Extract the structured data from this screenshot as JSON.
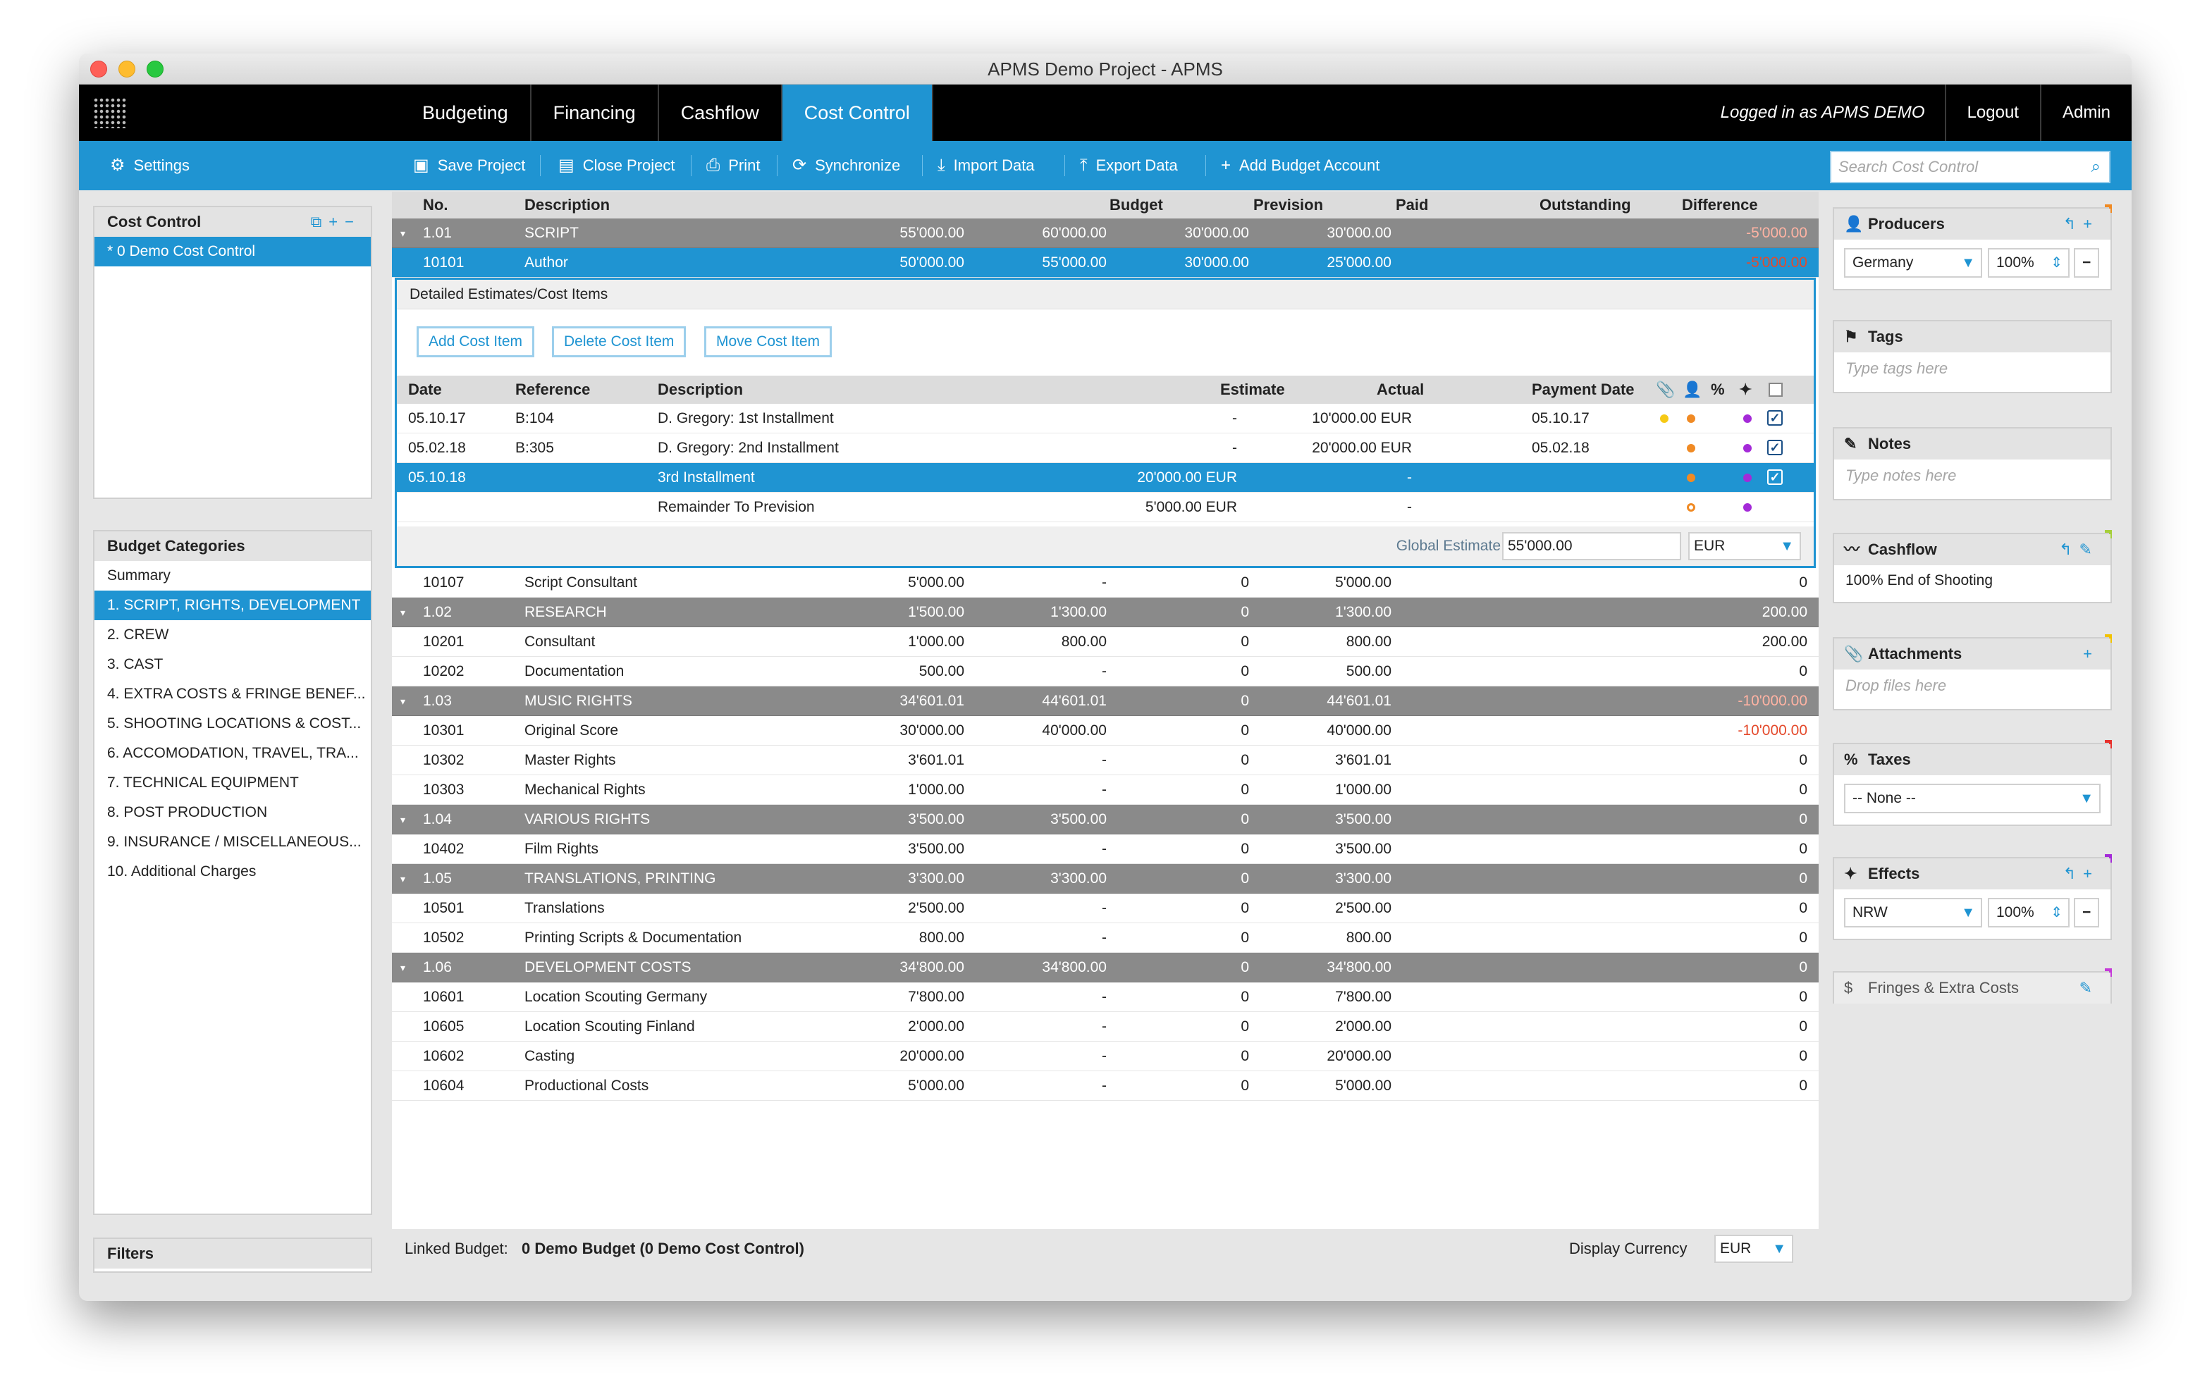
{
  "window": {
    "title": "APMS Demo Project - APMS"
  },
  "nav": {
    "tabs": [
      "Budgeting",
      "Financing",
      "Cashflow",
      "Cost Control"
    ],
    "active_tab": "Cost Control",
    "logged_in": "Logged in as APMS DEMO",
    "logout": "Logout",
    "admin": "Admin"
  },
  "toolbar": {
    "settings": "Settings",
    "save": "Save Project",
    "close": "Close Project",
    "print": "Print",
    "sync": "Synchronize",
    "import": "Import Data",
    "export": "Export Data",
    "add_account": "Add Budget Account",
    "search_placeholder": "Search Cost Control"
  },
  "cost_control_panel": {
    "title": "Cost Control",
    "items": [
      "* 0 Demo Cost Control"
    ]
  },
  "categories": {
    "title": "Budget Categories",
    "items": [
      "Summary",
      "1. SCRIPT, RIGHTS, DEVELOPMENT",
      "2. CREW",
      "3. CAST",
      "4. EXTRA COSTS & FRINGE BENEF...",
      "5. SHOOTING LOCATIONS & COST...",
      "6. ACCOMODATION, TRAVEL, TRA...",
      "7. TECHNICAL EQUIPMENT",
      "8. POST PRODUCTION",
      "9. INSURANCE / MISCELLANEOUS...",
      "10. Additional Charges"
    ],
    "selected": "1. SCRIPT, RIGHTS, DEVELOPMENT"
  },
  "filters": {
    "title": "Filters"
  },
  "table": {
    "headers": {
      "no": "No.",
      "desc": "Description",
      "budget": "Budget",
      "prevision": "Prevision",
      "paid": "Paid",
      "outstanding": "Outstanding",
      "difference": "Difference"
    },
    "top_rows": [
      {
        "type": "group",
        "no": "1.01",
        "desc": "SCRIPT",
        "budget": "55'000.00",
        "prevision": "60'000.00",
        "paid": "30'000.00",
        "outstanding": "30'000.00",
        "difference": "-5'000.00"
      },
      {
        "type": "selected",
        "no": "10101",
        "desc": "Author",
        "budget": "50'000.00",
        "prevision": "55'000.00",
        "paid": "30'000.00",
        "outstanding": "25'000.00",
        "difference": "-5'000.00"
      }
    ],
    "rows": [
      {
        "type": "item",
        "no": "10107",
        "desc": "Script Consultant",
        "budget": "5'000.00",
        "prevision": "-",
        "paid": "0",
        "outstanding": "5'000.00",
        "difference": "0"
      },
      {
        "type": "group",
        "no": "1.02",
        "desc": "RESEARCH",
        "budget": "1'500.00",
        "prevision": "1'300.00",
        "paid": "0",
        "outstanding": "1'300.00",
        "difference": "200.00"
      },
      {
        "type": "item",
        "no": "10201",
        "desc": "Consultant",
        "budget": "1'000.00",
        "prevision": "800.00",
        "paid": "0",
        "outstanding": "800.00",
        "difference": "200.00"
      },
      {
        "type": "item",
        "no": "10202",
        "desc": "Documentation",
        "budget": "500.00",
        "prevision": "-",
        "paid": "0",
        "outstanding": "500.00",
        "difference": "0"
      },
      {
        "type": "group",
        "no": "1.03",
        "desc": "MUSIC RIGHTS",
        "budget": "34'601.01",
        "prevision": "44'601.01",
        "paid": "0",
        "outstanding": "44'601.01",
        "difference": "-10'000.00"
      },
      {
        "type": "item",
        "no": "10301",
        "desc": "Original Score",
        "budget": "30'000.00",
        "prevision": "40'000.00",
        "paid": "0",
        "outstanding": "40'000.00",
        "difference": "-10'000.00"
      },
      {
        "type": "item",
        "no": "10302",
        "desc": "Master Rights",
        "budget": "3'601.01",
        "prevision": "-",
        "paid": "0",
        "outstanding": "3'601.01",
        "difference": "0"
      },
      {
        "type": "item",
        "no": "10303",
        "desc": "Mechanical Rights",
        "budget": "1'000.00",
        "prevision": "-",
        "paid": "0",
        "outstanding": "1'000.00",
        "difference": "0"
      },
      {
        "type": "group",
        "no": "1.04",
        "desc": "VARIOUS RIGHTS",
        "budget": "3'500.00",
        "prevision": "3'500.00",
        "paid": "0",
        "outstanding": "3'500.00",
        "difference": "0"
      },
      {
        "type": "item",
        "no": "10402",
        "desc": "Film Rights",
        "budget": "3'500.00",
        "prevision": "-",
        "paid": "0",
        "outstanding": "3'500.00",
        "difference": "0"
      },
      {
        "type": "group",
        "no": "1.05",
        "desc": "TRANSLATIONS, PRINTING",
        "budget": "3'300.00",
        "prevision": "3'300.00",
        "paid": "0",
        "outstanding": "3'300.00",
        "difference": "0"
      },
      {
        "type": "item",
        "no": "10501",
        "desc": "Translations",
        "budget": "2'500.00",
        "prevision": "-",
        "paid": "0",
        "outstanding": "2'500.00",
        "difference": "0"
      },
      {
        "type": "item",
        "no": "10502",
        "desc": "Printing Scripts & Documentation",
        "budget": "800.00",
        "prevision": "-",
        "paid": "0",
        "outstanding": "800.00",
        "difference": "0"
      },
      {
        "type": "group",
        "no": "1.06",
        "desc": "DEVELOPMENT COSTS",
        "budget": "34'800.00",
        "prevision": "34'800.00",
        "paid": "0",
        "outstanding": "34'800.00",
        "difference": "0"
      },
      {
        "type": "item",
        "no": "10601",
        "desc": "Location Scouting Germany",
        "budget": "7'800.00",
        "prevision": "-",
        "paid": "0",
        "outstanding": "7'800.00",
        "difference": "0"
      },
      {
        "type": "item",
        "no": "10605",
        "desc": "Location Scouting Finland",
        "budget": "2'000.00",
        "prevision": "-",
        "paid": "0",
        "outstanding": "2'000.00",
        "difference": "0"
      },
      {
        "type": "item",
        "no": "10602",
        "desc": "Casting",
        "budget": "20'000.00",
        "prevision": "-",
        "paid": "0",
        "outstanding": "20'000.00",
        "difference": "0"
      },
      {
        "type": "item",
        "no": "10604",
        "desc": "Productional Costs",
        "budget": "5'000.00",
        "prevision": "-",
        "paid": "0",
        "outstanding": "5'000.00",
        "difference": "0"
      }
    ]
  },
  "detail": {
    "title": "Detailed Estimates/Cost Items",
    "add": "Add Cost Item",
    "delete": "Delete Cost Item",
    "move": "Move Cost Item",
    "headers": {
      "date": "Date",
      "ref": "Reference",
      "desc": "Description",
      "estimate": "Estimate",
      "actual": "Actual",
      "paydate": "Payment Date",
      "pct": "%"
    },
    "rows": [
      {
        "date": "05.10.17",
        "ref": "B:104",
        "desc": "D. Gregory: 1st Installment",
        "estimate": "-",
        "actual": "10'000.00 EUR",
        "paydate": "05.10.17"
      },
      {
        "date": "05.02.18",
        "ref": "B:305",
        "desc": "D. Gregory: 2nd Installment",
        "estimate": "-",
        "actual": "20'000.00 EUR",
        "paydate": "05.02.18"
      },
      {
        "date": "05.10.18",
        "ref": "",
        "desc": "3rd Installment",
        "estimate": "20'000.00 EUR",
        "actual": "-",
        "paydate": ""
      },
      {
        "date": "",
        "ref": "",
        "desc": "Remainder To Prevision",
        "estimate": "5'000.00 EUR",
        "actual": "-",
        "paydate": ""
      }
    ],
    "global_label": "Global Estimate",
    "global_value": "55'000.00",
    "currency": "EUR"
  },
  "footer": {
    "linked_label": "Linked Budget:",
    "linked_value": "0 Demo Budget (0 Demo Cost Control)",
    "display_currency_label": "Display Currency",
    "display_currency": "EUR"
  },
  "right": {
    "producers": {
      "title": "Producers",
      "country": "Germany",
      "pct": "100%"
    },
    "tags": {
      "title": "Tags",
      "placeholder": "Type tags here"
    },
    "notes": {
      "title": "Notes",
      "placeholder": "Type notes here"
    },
    "cashflow": {
      "title": "Cashflow",
      "value": "100% End of Shooting"
    },
    "attachments": {
      "title": "Attachments",
      "placeholder": "Drop files here"
    },
    "taxes": {
      "title": "Taxes",
      "value": "-- None --"
    },
    "effects": {
      "title": "Effects",
      "region": "NRW",
      "pct": "100%"
    },
    "fringes": {
      "title": "Fringes & Extra Costs"
    }
  },
  "colors": {
    "accent": "#1f94d2",
    "group_row": "#8a8a8a",
    "negative": "#e44a2c"
  }
}
